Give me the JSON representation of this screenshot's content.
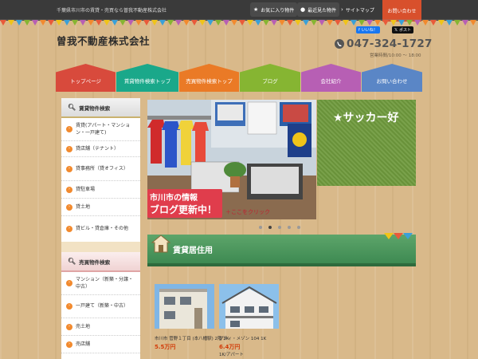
{
  "header": {
    "tagline": "千葉県市川市の賃貸・売買なら曽我不動産株式会社",
    "favorites_label": "お気に入り物件",
    "recent_label": "最近見た物件",
    "sitemap_label": "サイトマップ",
    "contact_label": "お問い合わせ",
    "company_name": "曽我不動産株式会社",
    "phone": "047-324-1727",
    "hours": "営業時間/10:00 ～ 18:00"
  },
  "nav": {
    "tabs": [
      {
        "label": "トップページ",
        "color": "#d84a3c"
      },
      {
        "label": "賃貸物件検索トップ",
        "color": "#1aa88a"
      },
      {
        "label": "売買物件検索トップ",
        "color": "#ea7a26"
      },
      {
        "label": "ブログ",
        "color": "#86b532"
      },
      {
        "label": "会社紹介",
        "color": "#b75fb4"
      },
      {
        "label": "お問い合わせ",
        "color": "#5a86c6"
      }
    ]
  },
  "sidebar": {
    "rent_heading": "賃貸物件検索",
    "rent_items": [
      "賃貸(アパート・マンション・一戸建て)",
      "貸店舗（テナント）",
      "貸事務所（貸オフィス）",
      "貸駐車場",
      "貸土地",
      "貸ビル・貸倉庫・その他"
    ],
    "sale_heading": "売買物件検索",
    "sale_items": [
      "マンション（新築・分譲・中古）",
      "一戸建て（新築・中古）",
      "売土地",
      "売店舗"
    ]
  },
  "slider": {
    "caption_line1": "市川市の情報",
    "caption_line2": "ブログ更新中！",
    "click_label": "＋ここをクリック",
    "next_text": "★サッカー好",
    "active_index": 1,
    "dot_count": 5
  },
  "social": {
    "like_label": "いいね！",
    "post_label": "ポスト"
  },
  "rent_section": {
    "title": "賃貸居住用",
    "cards": [
      {
        "title": "市川市 菅野１丁目 (本八幡駅) 2階 2K",
        "price": "5.5万円",
        "sub": ""
      },
      {
        "title": "プティ・メゾン 104 1K",
        "price": "6.4万円",
        "sub": "1K/アパート"
      }
    ]
  },
  "colors": {
    "topbar": "#3a3a3a",
    "accent_red": "#d8502c",
    "rent_green": "#4a9a5e",
    "arrow_orange": "#f28a2e",
    "price_red": "#d23c0a"
  }
}
